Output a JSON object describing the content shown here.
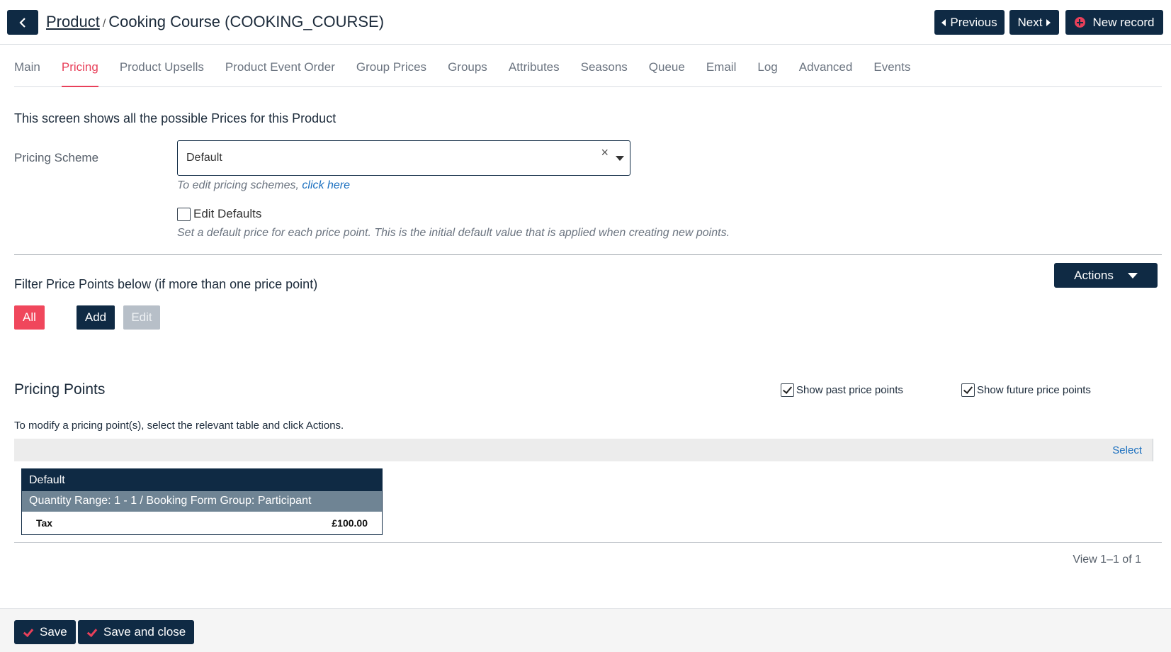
{
  "header": {
    "breadcrumb_parent": "Product",
    "breadcrumb_separator": "/",
    "breadcrumb_current": "Cooking Course (COOKING_COURSE)",
    "previous_label": "Previous",
    "next_label": "Next",
    "new_record_label": "New record"
  },
  "tabs": [
    {
      "label": "Main",
      "active": false
    },
    {
      "label": "Pricing",
      "active": true
    },
    {
      "label": "Product Upsells",
      "active": false
    },
    {
      "label": "Product Event Order",
      "active": false
    },
    {
      "label": "Group Prices",
      "active": false
    },
    {
      "label": "Groups",
      "active": false
    },
    {
      "label": "Attributes",
      "active": false
    },
    {
      "label": "Seasons",
      "active": false
    },
    {
      "label": "Queue",
      "active": false
    },
    {
      "label": "Email",
      "active": false
    },
    {
      "label": "Log",
      "active": false
    },
    {
      "label": "Advanced",
      "active": false
    },
    {
      "label": "Events",
      "active": false
    }
  ],
  "pricing": {
    "intro": "This screen shows all the possible Prices for this Product",
    "scheme_label": "Pricing Scheme",
    "scheme_value": "Default",
    "scheme_clear": "×",
    "hint_text": "To edit pricing schemes,",
    "hint_link": "click here",
    "edit_defaults_label": "Edit Defaults",
    "edit_defaults_checked": false,
    "defaults_desc": "Set a default price for each price point. This is the initial default value that is applied when creating new points."
  },
  "filter": {
    "title": "Filter Price Points below (if more than one price point)",
    "actions_label": "Actions",
    "all_label": "All",
    "add_label": "Add",
    "edit_label": "Edit"
  },
  "points": {
    "title": "Pricing Points",
    "show_past_label": "Show past price points",
    "show_past_checked": true,
    "show_future_label": "Show future price points",
    "show_future_checked": true,
    "modify_text": "To modify a pricing point(s), select the relevant table and click Actions.",
    "select_label": "Select",
    "table": {
      "header": "Default",
      "subheader": "Quantity Range: 1 - 1 / Booking Form Group: Participant",
      "rows": [
        {
          "label": "Tax",
          "value": "£100.00"
        }
      ]
    },
    "view_count": "View 1–1 of 1"
  },
  "footer": {
    "save_label": "Save",
    "save_close_label": "Save and close"
  },
  "colors": {
    "navy": "#0f2a44",
    "accent_red": "#e8405a",
    "link_blue": "#1a6fbf"
  }
}
